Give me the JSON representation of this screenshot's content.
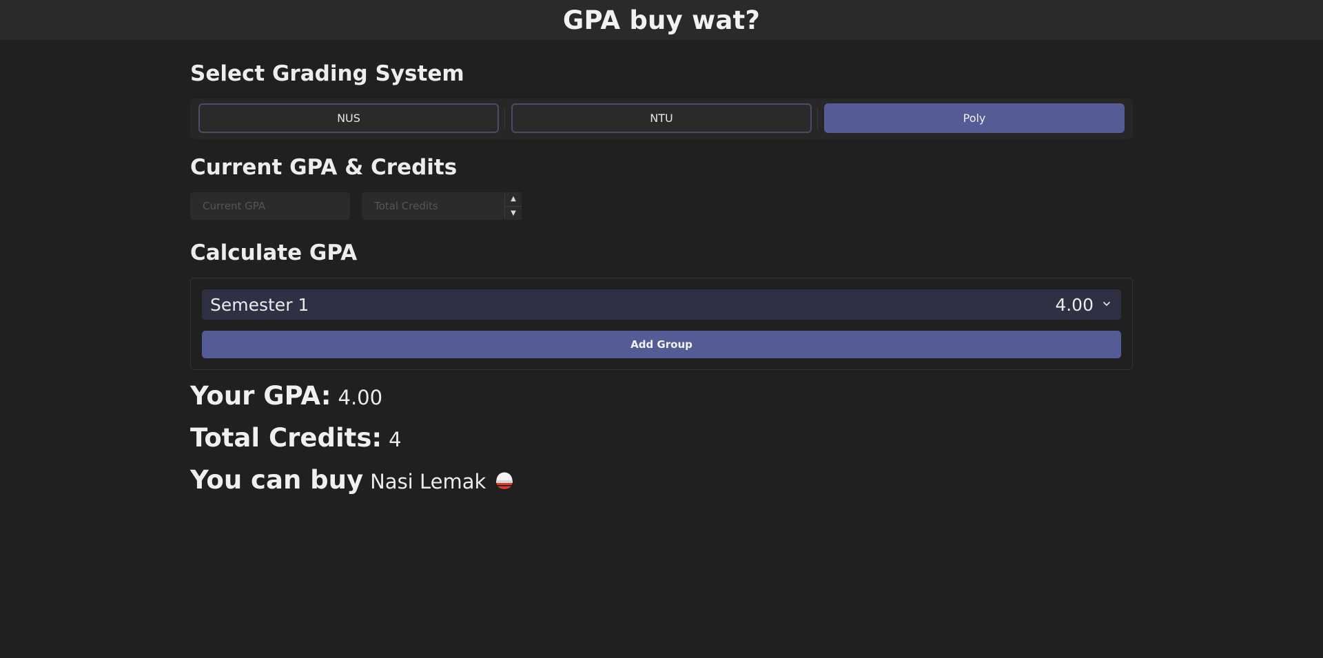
{
  "header": {
    "title": "GPA buy wat?"
  },
  "grading": {
    "heading": "Select Grading System",
    "options": [
      "NUS",
      "NTU",
      "Poly"
    ],
    "selected": "Poly"
  },
  "current": {
    "heading": "Current GPA & Credits",
    "gpa_placeholder": "Current GPA",
    "credits_placeholder": "Total Credits"
  },
  "calculate": {
    "heading": "Calculate GPA",
    "semester_name": "Semester 1",
    "semester_gpa": "4.00",
    "add_group_label": "Add Group"
  },
  "results": {
    "gpa_label": "Your GPA:",
    "gpa_value": "4.00",
    "credits_label": "Total Credits:",
    "credits_value": "4",
    "buy_label": "You can buy",
    "buy_value": "Nasi Lemak",
    "buy_icon": "rice-bowl-icon"
  },
  "colors": {
    "accent": "#555b94",
    "background": "#202020",
    "header_bg": "#2a2a2a",
    "semester_row_bg": "#2f3043"
  }
}
